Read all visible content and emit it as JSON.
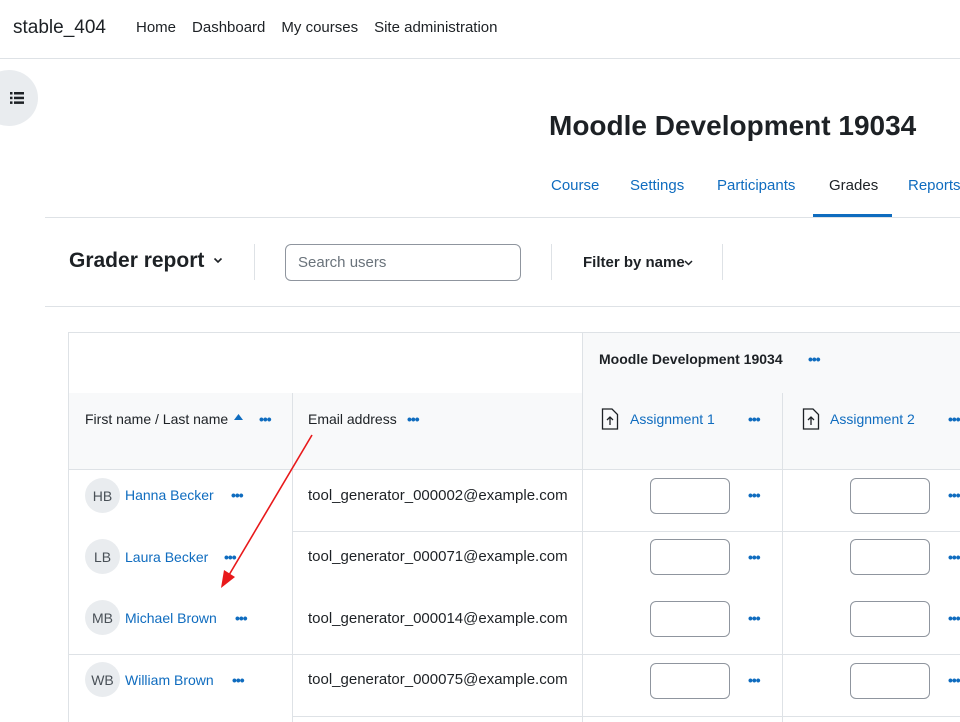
{
  "navbar": {
    "site_name": "stable_404",
    "links": [
      "Home",
      "Dashboard",
      "My courses",
      "Site administration"
    ]
  },
  "drawer": {
    "icon": "list-icon"
  },
  "course": {
    "title": "Moodle Development 19034",
    "tabs": [
      "Course",
      "Settings",
      "Participants",
      "Grades",
      "Reports"
    ],
    "active_tab": "Grades"
  },
  "toolbar": {
    "report_title": "Grader report",
    "search_placeholder": "Search users",
    "filter_label": "Filter by name"
  },
  "grader": {
    "category_title": "Moodle Development 19034",
    "col_name": "First name / Last name",
    "col_email": "Email address",
    "assignments": [
      "Assignment 1",
      "Assignment 2"
    ],
    "actions_glyph": "•••",
    "students": [
      {
        "initials": "HB",
        "name": "Hanna Becker",
        "email": "tool_generator_000002@example.com"
      },
      {
        "initials": "LB",
        "name": "Laura Becker",
        "email": "tool_generator_000071@example.com"
      },
      {
        "initials": "MB",
        "name": "Michael Brown",
        "email": "tool_generator_000014@example.com"
      },
      {
        "initials": "WB",
        "name": "William Brown",
        "email": "tool_generator_000075@example.com"
      }
    ]
  },
  "colors": {
    "link": "#0f6cbf",
    "text": "#1d2125",
    "border": "#dee2e6",
    "annotation_arrow": "#e8191b"
  }
}
